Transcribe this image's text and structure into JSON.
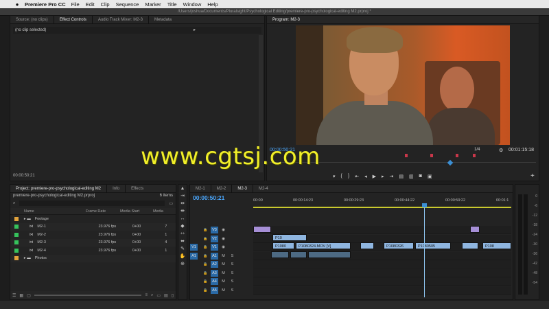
{
  "menubar": {
    "apple": "",
    "app": "Premiere Pro CC",
    "items": [
      "File",
      "Edit",
      "Clip",
      "Sequence",
      "Marker",
      "Title",
      "Window",
      "Help"
    ]
  },
  "path": "/Users/joshua/Documents/Pluralsight/Psychological Editing/premiere-pro-psychological-editing M2.prproj *",
  "source_panel": {
    "tabs": [
      "Source: (no clips)",
      "Effect Controls",
      "Audio Track Mixer: M2-3",
      "Metadata"
    ],
    "noclip": "(no clip selected)",
    "timecode": "00:00:50:21"
  },
  "program": {
    "title": "Program: M2-3",
    "tc_left": "00:00:50:21",
    "fraction": "1/4",
    "tc_right": "00:01:15:18"
  },
  "project": {
    "tabs": [
      "Project: premiere-pro-psychological-editing M2",
      "Info",
      "Effects"
    ],
    "file": "premiere-pro-psychological-editing M2.prproj",
    "count": "6 items",
    "columns": [
      "Name",
      "Frame Rate",
      "Media Start",
      "Media"
    ],
    "rows": [
      {
        "name": "Footage",
        "fr": "",
        "ms": "",
        "md": "",
        "color": "#e2a33c",
        "folder": true
      },
      {
        "name": "M2-1",
        "fr": "23.976 fps",
        "ms": "0+00",
        "md": "7",
        "color": "#36c25c",
        "folder": false
      },
      {
        "name": "M2-2",
        "fr": "23.976 fps",
        "ms": "0+00",
        "md": "1",
        "color": "#36c25c",
        "folder": false
      },
      {
        "name": "M2-3",
        "fr": "23.976 fps",
        "ms": "0+00",
        "md": "4",
        "color": "#36c25c",
        "folder": false
      },
      {
        "name": "M2-4",
        "fr": "23.976 fps",
        "ms": "0+00",
        "md": "1",
        "color": "#36c25c",
        "folder": false
      },
      {
        "name": "Photos",
        "fr": "",
        "ms": "",
        "md": "",
        "color": "#e2a33c",
        "folder": true
      }
    ]
  },
  "timeline": {
    "tabs": [
      "M2-1",
      "M2-2",
      "M2-3",
      "M2-4"
    ],
    "timecode": "00:00:50:21",
    "ruler": [
      "00:00",
      "00:00:14:23",
      "00:00:29:23",
      "00:00:44:22",
      "00:00:59:22",
      "00:01:1"
    ],
    "tracks": [
      {
        "left": "",
        "label": "V3"
      },
      {
        "left": "",
        "label": "V2"
      },
      {
        "left": "V1",
        "label": "V1"
      },
      {
        "left": "A1",
        "label": "A1"
      },
      {
        "left": "",
        "label": "A2"
      },
      {
        "left": "",
        "label": "A3"
      },
      {
        "left": "",
        "label": "A4"
      },
      {
        "left": "",
        "label": "A5"
      }
    ],
    "clips_v2": [
      "P10"
    ],
    "clips_v1": [
      "P1080",
      "P1080324.MOV [V]",
      "P1080326",
      "P1080505",
      "P108"
    ]
  },
  "meter": {
    "levels": [
      "0",
      "-6",
      "-12",
      "-18",
      "-24",
      "-30",
      "-36",
      "-42",
      "-48",
      "-54"
    ]
  },
  "watermark": "www.cgtsj.com",
  "colors": {
    "accent": "#3b8fd4",
    "label_violet": "#a68fd6",
    "label_blue": "#8fb6e0"
  }
}
